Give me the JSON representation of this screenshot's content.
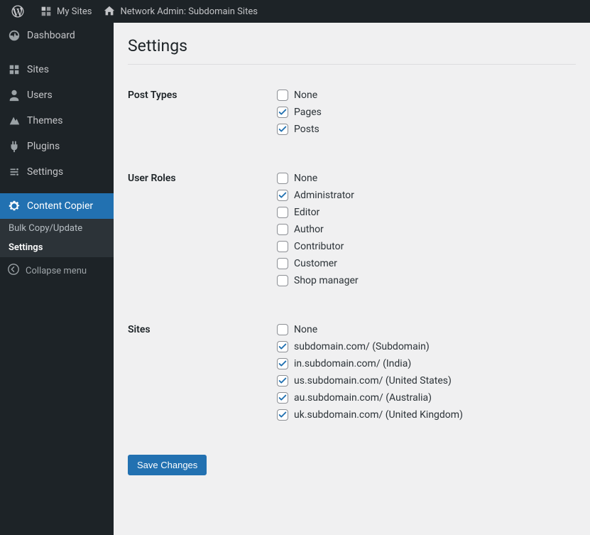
{
  "toolbar": {
    "my_sites": "My Sites",
    "network_admin": "Network Admin: Subdomain Sites"
  },
  "sidebar": {
    "items": [
      {
        "id": "dashboard",
        "label": "Dashboard",
        "icon": "dashboard"
      },
      {
        "id": "sites",
        "label": "Sites",
        "icon": "sites"
      },
      {
        "id": "users",
        "label": "Users",
        "icon": "users"
      },
      {
        "id": "themes",
        "label": "Themes",
        "icon": "themes"
      },
      {
        "id": "plugins",
        "label": "Plugins",
        "icon": "plugins"
      },
      {
        "id": "settings",
        "label": "Settings",
        "icon": "settings"
      },
      {
        "id": "content-copier",
        "label": "Content Copier",
        "icon": "gear",
        "current": true
      }
    ],
    "sub": [
      {
        "label": "Bulk Copy/Update",
        "current": false
      },
      {
        "label": "Settings",
        "current": true
      }
    ],
    "collapse": "Collapse menu"
  },
  "page": {
    "title": "Settings"
  },
  "form": {
    "sections": [
      {
        "label": "Post Types",
        "options": [
          {
            "label": "None",
            "checked": false
          },
          {
            "label": "Pages",
            "checked": true
          },
          {
            "label": "Posts",
            "checked": true
          }
        ]
      },
      {
        "label": "User Roles",
        "options": [
          {
            "label": "None",
            "checked": false
          },
          {
            "label": "Administrator",
            "checked": true
          },
          {
            "label": "Editor",
            "checked": false
          },
          {
            "label": "Author",
            "checked": false
          },
          {
            "label": "Contributor",
            "checked": false
          },
          {
            "label": "Customer",
            "checked": false
          },
          {
            "label": "Shop manager",
            "checked": false
          }
        ]
      },
      {
        "label": "Sites",
        "options": [
          {
            "label": "None",
            "checked": false
          },
          {
            "label": "subdomain.com/ (Subdomain)",
            "checked": true
          },
          {
            "label": "in.subdomain.com/ (India)",
            "checked": true
          },
          {
            "label": "us.subdomain.com/ (United States)",
            "checked": true
          },
          {
            "label": "au.subdomain.com/ (Australia)",
            "checked": true
          },
          {
            "label": "uk.subdomain.com/ (United Kingdom)",
            "checked": true
          }
        ]
      }
    ],
    "submit": "Save Changes"
  }
}
